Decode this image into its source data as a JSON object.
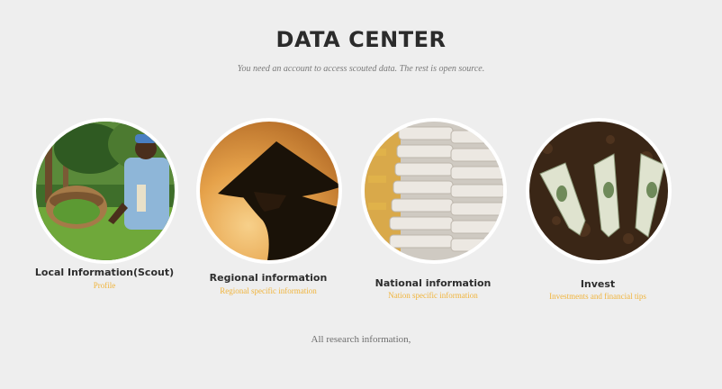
{
  "header": {
    "title": "DATA CENTER",
    "subtitle": "You need an account to access scouted data. The rest is open source."
  },
  "cards": [
    {
      "title": "Local Information(Scout)",
      "subtitle": "Profile",
      "image": "farmer-picking-tea-photo"
    },
    {
      "title": "Regional information",
      "subtitle": "Regional specific information",
      "image": "conical-hat-silhouette-photo"
    },
    {
      "title": "National information",
      "subtitle": "Nation specific information",
      "image": "grain-sacks-photo"
    },
    {
      "title": "Invest",
      "subtitle": "Investments and financial tips",
      "image": "money-plants-photo"
    }
  ],
  "footer": {
    "text": "All research information,"
  },
  "colors": {
    "background": "#eeeeee",
    "accent": "#f0b43c",
    "title": "#2b2b2b"
  }
}
